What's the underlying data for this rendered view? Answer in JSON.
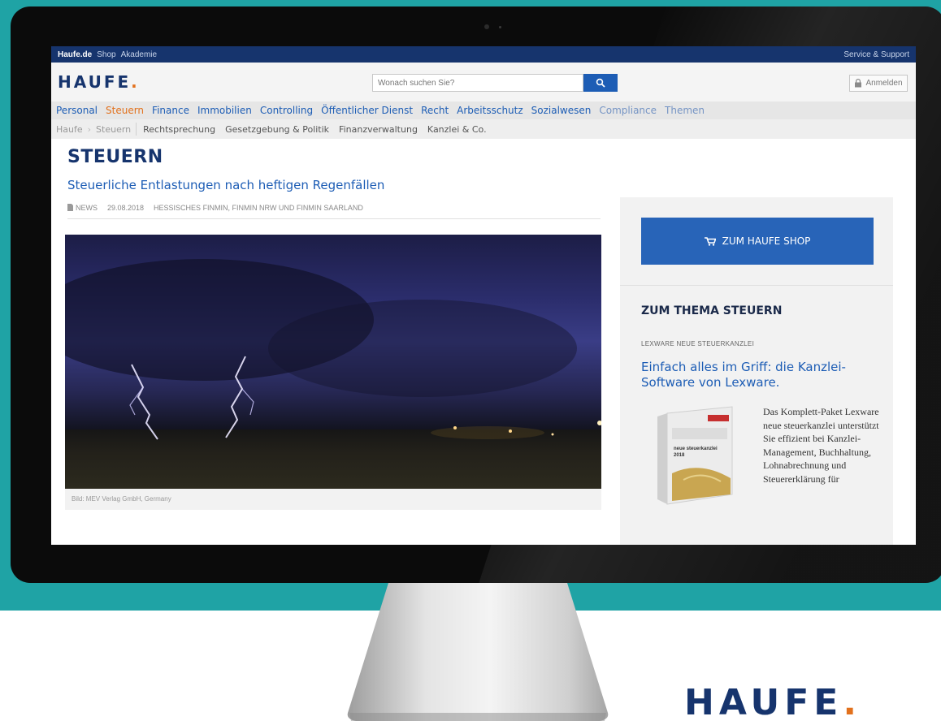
{
  "topbar": {
    "items": [
      "Haufe.de",
      "Shop",
      "Akademie"
    ],
    "right": "Service & Support"
  },
  "header": {
    "logo": "HAUFE",
    "logo_dot": ".",
    "search_placeholder": "Wonach suchen Sie?",
    "login_label": "Anmelden"
  },
  "mainnav": {
    "items": [
      {
        "label": "Personal"
      },
      {
        "label": "Steuern"
      },
      {
        "label": "Finance"
      },
      {
        "label": "Immobilien"
      },
      {
        "label": "Controlling"
      },
      {
        "label": "Öffentlicher Dienst"
      },
      {
        "label": "Recht"
      },
      {
        "label": "Arbeitsschutz"
      },
      {
        "label": "Sozialwesen"
      },
      {
        "label": "Compliance"
      },
      {
        "label": "Themen"
      }
    ]
  },
  "subnav": {
    "breadcrumb": [
      "Haufe",
      "Steuern"
    ],
    "items": [
      "Rechtsprechung",
      "Gesetzgebung & Politik",
      "Finanzverwaltung",
      "Kanzlei & Co."
    ]
  },
  "article": {
    "section_title": "STEUERN",
    "title": "Steuerliche Entlastungen nach heftigen Regenfällen",
    "type": "NEWS",
    "date": "29.08.2018",
    "source": "HESSISCHES FINMIN, FINMIN NRW UND FINMIN SAARLAND",
    "image_caption": "Bild: MEV Verlag GmbH, Germany"
  },
  "sidebar": {
    "shop_button": "ZUM HAUFE SHOP",
    "title": "ZUM THEMA STEUERN",
    "kicker": "LEXWARE NEUE STEUERKANZLEI",
    "headline": "Einfach alles im Griff: die Kanzlei-Software von Lexware.",
    "text": "Das Komplett-Paket Lexware neue steuerkanzlei unterstützt Sie effizient bei Kanzlei-Management, Buchhaltung, Lohnabrechnung und Steuererklärung für",
    "product_label": "neue steuerkanzlei 2018"
  },
  "brand": {
    "logo": "HAUFE",
    "dot": "."
  },
  "colors": {
    "teal": "#1fa3a5",
    "navy": "#16346d",
    "blue": "#1d5db5",
    "orange": "#e2711d"
  }
}
